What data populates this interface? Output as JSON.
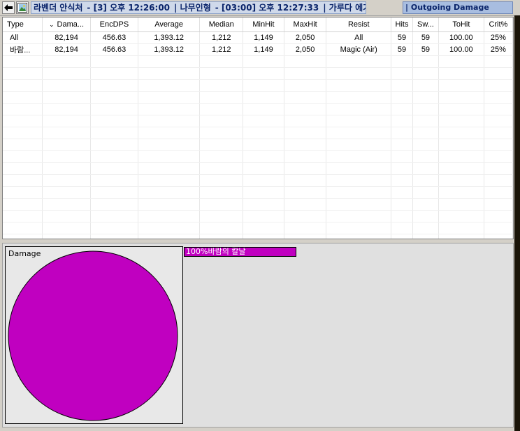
{
  "colors": {
    "slice": "#c000c0",
    "title_text": "#0a246a"
  },
  "titlebar": {
    "back_icon": "arrow-left-icon",
    "image_icon": "picture-icon",
    "crumbs": [
      "라벤더 안식처",
      "- [3] 오후 12:26:00",
      "| 나무인형",
      "- [03:00] 오후 12:27:33",
      "| 가루다 에기"
    ],
    "view_label": "| Outgoing Damage"
  },
  "table": {
    "columns": [
      "Type",
      "Dama...",
      "EncDPS",
      "Average",
      "Median",
      "MinHit",
      "MaxHit",
      "Resist",
      "Hits",
      "Sw...",
      "ToHit",
      "Crit%"
    ],
    "rows": [
      [
        "All",
        "82,194",
        "456.63",
        "1,393.12",
        "1,212",
        "1,149",
        "2,050",
        "All",
        "59",
        "59",
        "100.00",
        "25%"
      ],
      [
        "바람...",
        "82,194",
        "456.63",
        "1,393.12",
        "1,212",
        "1,149",
        "2,050",
        "Magic (Air)",
        "59",
        "59",
        "100.00",
        "25%"
      ]
    ]
  },
  "pie": {
    "title": "Damage",
    "legend": "100%바람의 칼날"
  },
  "chart_data": {
    "type": "pie",
    "title": "Damage",
    "categories": [
      "바람의 칼날"
    ],
    "values": [
      100
    ]
  }
}
